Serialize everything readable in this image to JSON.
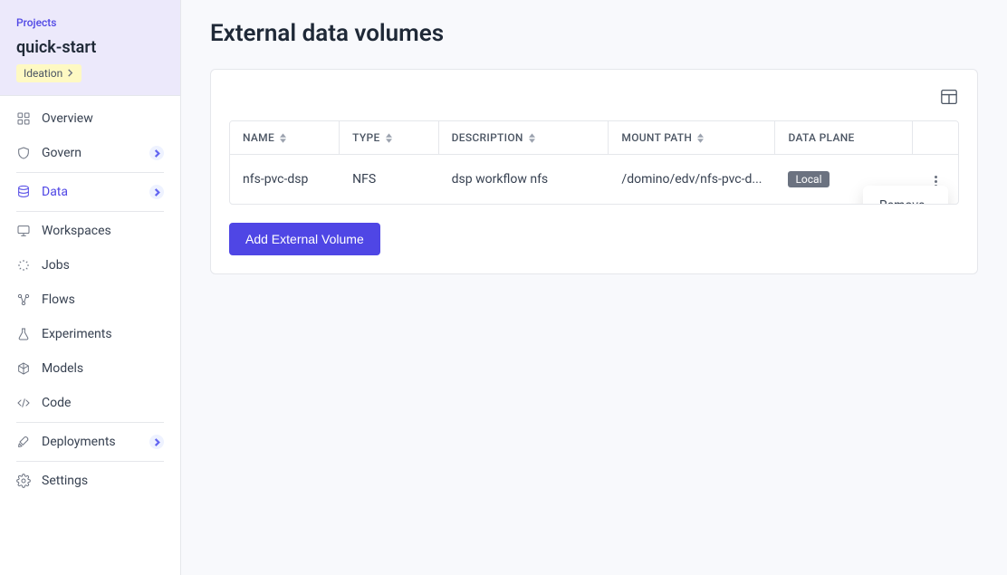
{
  "sidebar": {
    "projects_label": "Projects",
    "project_name": "quick-start",
    "stage_badge": "Ideation",
    "nav": [
      {
        "key": "overview",
        "label": "Overview",
        "icon": "grid",
        "badge": false
      },
      {
        "key": "govern",
        "label": "Govern",
        "icon": "shield",
        "badge": true
      },
      {
        "key": "data",
        "label": "Data",
        "icon": "database",
        "badge": true,
        "active": true
      },
      {
        "key": "workspaces",
        "label": "Workspaces",
        "icon": "monitor",
        "badge": false
      },
      {
        "key": "jobs",
        "label": "Jobs",
        "icon": "loader",
        "badge": false
      },
      {
        "key": "flows",
        "label": "Flows",
        "icon": "flow",
        "badge": false
      },
      {
        "key": "experiments",
        "label": "Experiments",
        "icon": "flask",
        "badge": false
      },
      {
        "key": "models",
        "label": "Models",
        "icon": "cube",
        "badge": false
      },
      {
        "key": "code",
        "label": "Code",
        "icon": "code",
        "badge": false
      },
      {
        "key": "deployments",
        "label": "Deployments",
        "icon": "rocket",
        "badge": true
      },
      {
        "key": "settings",
        "label": "Settings",
        "icon": "gear",
        "badge": false
      }
    ]
  },
  "page": {
    "title": "External data volumes",
    "add_button": "Add External Volume"
  },
  "table": {
    "columns": {
      "name": "NAME",
      "type": "TYPE",
      "description": "DESCRIPTION",
      "mount_path": "MOUNT PATH",
      "data_plane": "DATA PLANE"
    },
    "rows": [
      {
        "name": "nfs-pvc-dsp",
        "type": "NFS",
        "description": "dsp workflow nfs",
        "mount_path": "/domino/edv/nfs-pvc-d...",
        "data_plane": "Local"
      }
    ]
  },
  "menu": {
    "remove": "Remove"
  }
}
